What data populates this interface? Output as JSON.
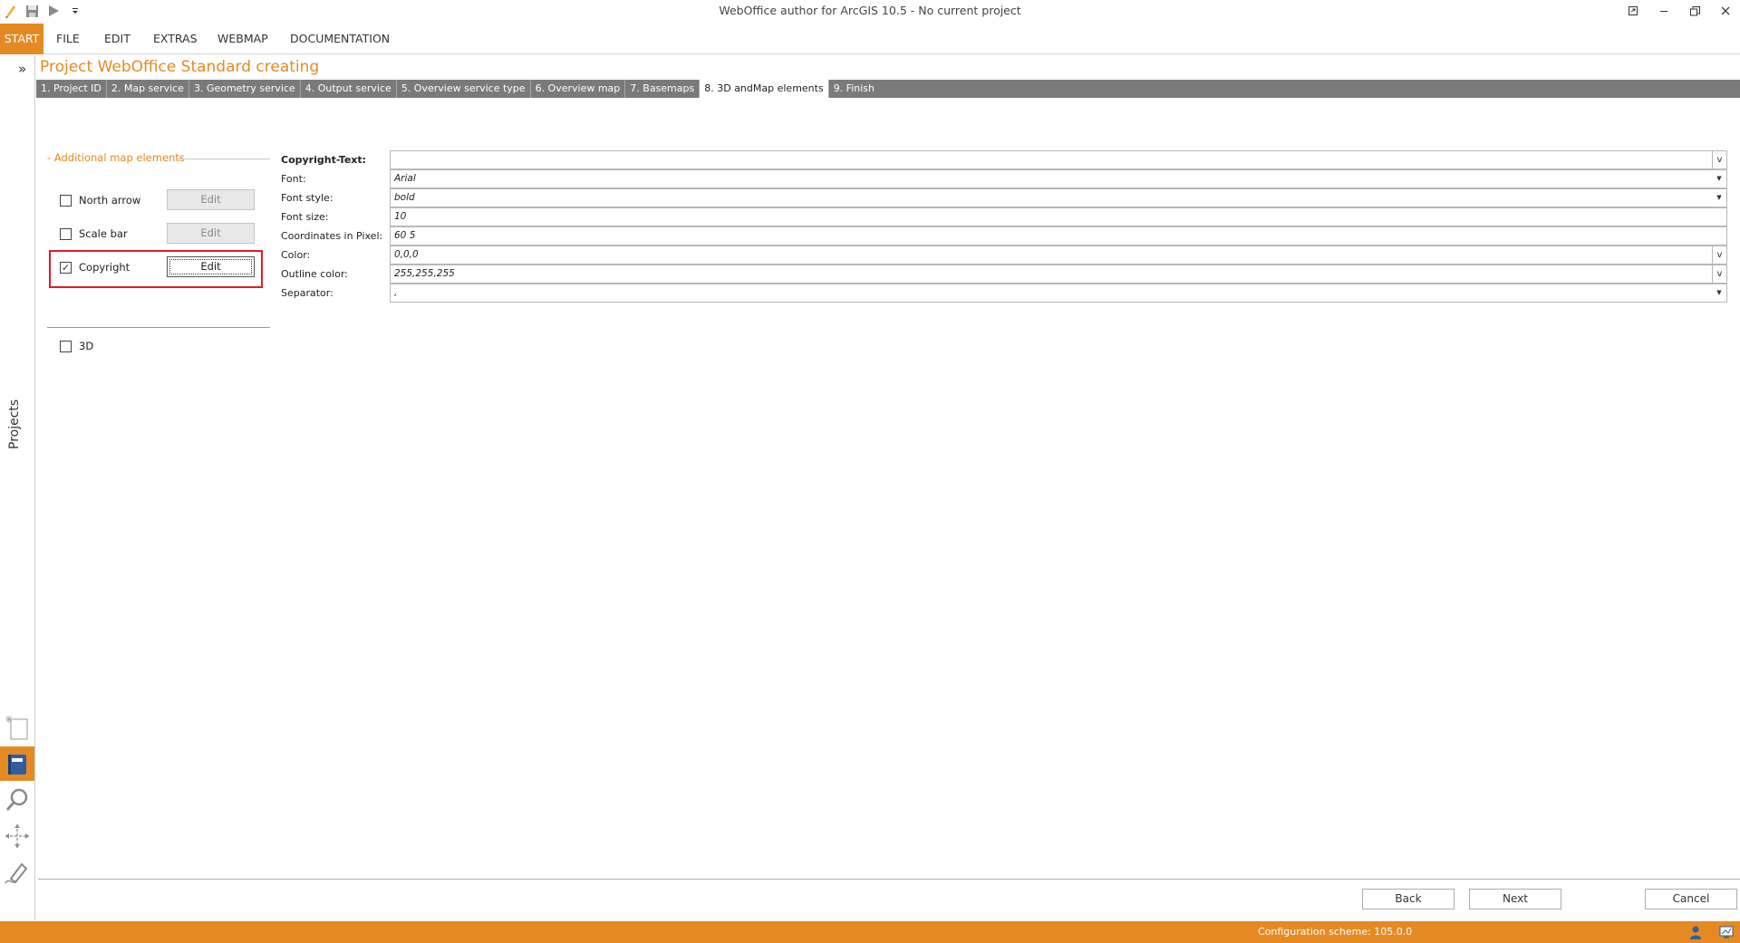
{
  "window": {
    "title": "WebOffice author for ArcGIS 10.5 - No current project",
    "controls": [
      "restore-down-icon",
      "minimize-icon",
      "maximize-icon",
      "close-icon"
    ]
  },
  "menu": {
    "start": "START",
    "file": "FILE",
    "edit": "EDIT",
    "extras": "EXTRAS",
    "webmap": "WEBMAP",
    "documentation": "DOCUMENTATION"
  },
  "sidebar": {
    "expand": "»",
    "projects_label": "Projects",
    "tools": [
      "new-project-icon",
      "project-list-icon",
      "search-icon",
      "move-tool-icon",
      "edit-pen-icon"
    ]
  },
  "page": {
    "title": "Project WebOffice Standard creating"
  },
  "tabs": [
    "1. Project ID",
    "2. Map service",
    "3. Geometry service",
    "4. Output service",
    "5. Overview service type",
    "6. Overview map",
    "7. Basemaps",
    "8. 3D andMap elements",
    "9. Finish"
  ],
  "active_tab_index": 7,
  "options": {
    "section_title": "- Additional map elements",
    "north_arrow": {
      "label": "North arrow",
      "checked": false,
      "edit": "Edit"
    },
    "scale_bar": {
      "label": "Scale bar",
      "checked": false,
      "edit": "Edit"
    },
    "copyright": {
      "label": "Copyright",
      "checked": true,
      "check_mark": "✓",
      "edit": "Edit"
    },
    "three_d": {
      "label": "3D",
      "checked": false
    }
  },
  "properties": {
    "copyright_text": {
      "label": "Copyright-Text:",
      "value": "",
      "button": "v"
    },
    "font": {
      "label": "Font:",
      "value": "Arial"
    },
    "font_style": {
      "label": "Font style:",
      "value": "bold"
    },
    "font_size": {
      "label": "Font size:",
      "value": "10"
    },
    "coordinates": {
      "label": "Coordinates in Pixel:",
      "value": "60 5"
    },
    "color": {
      "label": "Color:",
      "value": "0,0,0",
      "button": "v"
    },
    "outline_color": {
      "label": "Outline color:",
      "value": "255,255,255",
      "button": "v"
    },
    "separator": {
      "label": "Separator:",
      "value": ","
    }
  },
  "buttons": {
    "back": "Back",
    "next": "Next",
    "cancel": "Cancel"
  },
  "status": {
    "configuration": "Configuration scheme:  105.0.0"
  },
  "colors": {
    "accent": "#e58a22",
    "highlight": "#e11b22",
    "tab_bar": "#7a7a7a"
  }
}
